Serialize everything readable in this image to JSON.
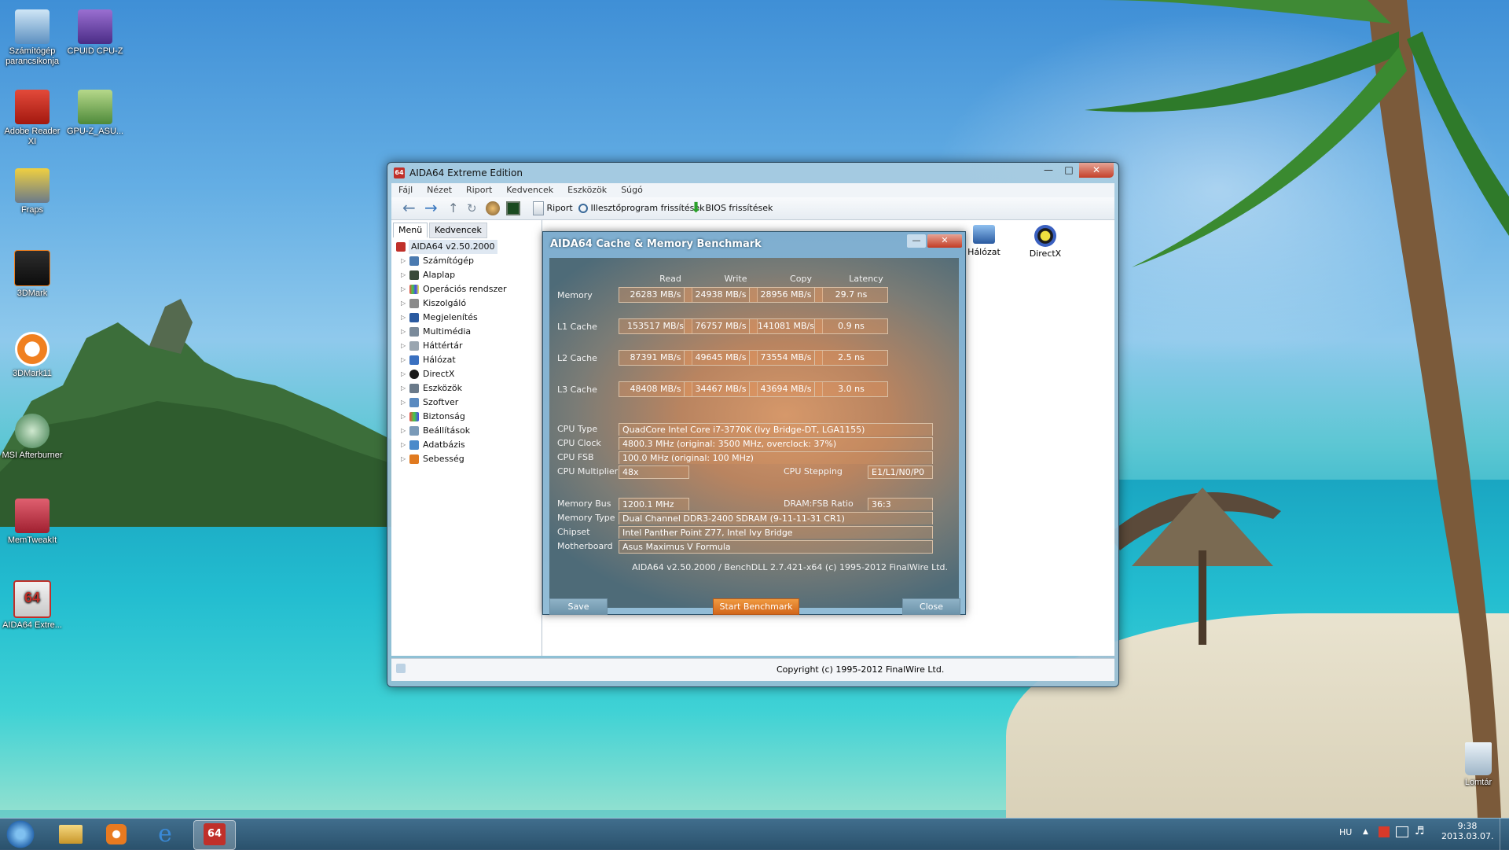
{
  "desktop": {
    "icons": [
      {
        "label": "Számítógép parancsikonja"
      },
      {
        "label": "CPUID CPU-Z"
      },
      {
        "label": "Adobe Reader XI"
      },
      {
        "label": "GPU-Z_ASU..."
      },
      {
        "label": "Fraps"
      },
      {
        "label": "3DMark"
      },
      {
        "label": "3DMark11"
      },
      {
        "label": "MSI Afterburner"
      },
      {
        "label": "MemTweakIt"
      },
      {
        "label": "AIDA64 Extre..."
      },
      {
        "label": "Lomtár"
      }
    ]
  },
  "aida": {
    "title": "AIDA64 Extreme Edition",
    "menu": [
      "Fájl",
      "Nézet",
      "Riport",
      "Kedvencek",
      "Eszközök",
      "Súgó"
    ],
    "toolbar": {
      "report": "Riport",
      "driver_update": "Illesztőprogram frissítések",
      "bios_update": "BIOS frissítések"
    },
    "tabs": {
      "menu": "Menü",
      "favorites": "Kedvencek"
    },
    "tree_root": "AIDA64 v2.50.2000",
    "tree": [
      "Számítógép",
      "Alaplap",
      "Operációs rendszer",
      "Kiszolgáló",
      "Megjelenítés",
      "Multimédia",
      "Háttértár",
      "Hálózat",
      "DirectX",
      "Eszközök",
      "Szoftver",
      "Biztonság",
      "Beállítások",
      "Adatbázis",
      "Sebesség"
    ],
    "pane_icons": {
      "network": "Hálózat",
      "directx": "DirectX"
    },
    "status": "Copyright (c) 1995-2012 FinalWire Ltd."
  },
  "bench": {
    "title": "AIDA64 Cache & Memory Benchmark",
    "columns": {
      "read": "Read",
      "write": "Write",
      "copy": "Copy",
      "latency": "Latency"
    },
    "rows": [
      {
        "label": "Memory",
        "read": "26283 MB/s",
        "write": "24938 MB/s",
        "copy": "28956 MB/s",
        "latency": "29.7 ns"
      },
      {
        "label": "L1 Cache",
        "read": "153517 MB/s",
        "write": "76757 MB/s",
        "copy": "141081 MB/s",
        "latency": "0.9 ns"
      },
      {
        "label": "L2 Cache",
        "read": "87391 MB/s",
        "write": "49645 MB/s",
        "copy": "73554 MB/s",
        "latency": "2.5 ns"
      },
      {
        "label": "L3 Cache",
        "read": "48408 MB/s",
        "write": "34467 MB/s",
        "copy": "43694 MB/s",
        "latency": "3.0 ns"
      }
    ],
    "info": {
      "cpu_type_label": "CPU Type",
      "cpu_type": "QuadCore Intel Core i7-3770K  (Ivy Bridge-DT, LGA1155)",
      "cpu_clock_label": "CPU Clock",
      "cpu_clock": "4800.3 MHz  (original: 3500 MHz, overclock: 37%)",
      "cpu_fsb_label": "CPU FSB",
      "cpu_fsb": "100.0 MHz  (original: 100 MHz)",
      "cpu_mult_label": "CPU Multiplier",
      "cpu_mult": "48x",
      "cpu_stepping_label": "CPU Stepping",
      "cpu_stepping": "E1/L1/N0/P0",
      "mem_bus_label": "Memory Bus",
      "mem_bus": "1200.1 MHz",
      "dram_ratio_label": "DRAM:FSB Ratio",
      "dram_ratio": "36:3",
      "mem_type_label": "Memory Type",
      "mem_type": "Dual Channel DDR3-2400 SDRAM  (9-11-11-31 CR1)",
      "chipset_label": "Chipset",
      "chipset": "Intel Panther Point Z77, Intel Ivy Bridge",
      "motherboard_label": "Motherboard",
      "motherboard": "Asus Maximus V Formula"
    },
    "footer": "AIDA64 v2.50.2000 / BenchDLL 2.7.421-x64  (c) 1995-2012 FinalWire Ltd.",
    "buttons": {
      "save": "Save",
      "start": "Start Benchmark",
      "close": "Close"
    }
  },
  "taskbar": {
    "lang": "HU",
    "time": "9:38",
    "date": "2013.03.07."
  }
}
